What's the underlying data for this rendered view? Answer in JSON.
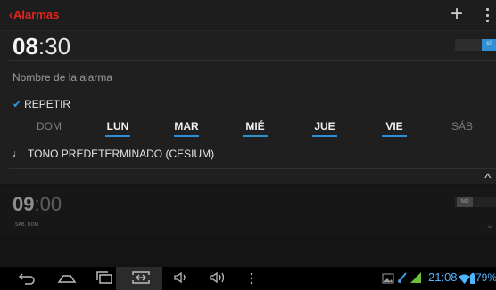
{
  "action_bar": {
    "back_chevron": "‹",
    "title": "Alarmas",
    "add_icon": "+",
    "accent": "#e8221c"
  },
  "alarm1": {
    "time_hour": "08",
    "time_minute": ":30",
    "switch_label": "SÍ",
    "name_placeholder": "Nombre de la alarma",
    "repeat_label": "REPETIR",
    "days": [
      {
        "label": "DOM",
        "active": false
      },
      {
        "label": "LUN",
        "active": true
      },
      {
        "label": "MAR",
        "active": true
      },
      {
        "label": "MIÉ",
        "active": true
      },
      {
        "label": "JUE",
        "active": true
      },
      {
        "label": "VIE",
        "active": true
      },
      {
        "label": "SÁB",
        "active": false
      }
    ],
    "ringtone": "TONO PREDETERMINADO (CESIUM)",
    "switch_color": "#2f8fd2"
  },
  "alarm2": {
    "time_hour": "09",
    "time_minute": ":00",
    "switch_label": "NO",
    "days_summary": "SÁB, DOM"
  },
  "status_bar": {
    "time": "21:08",
    "battery": "79%"
  }
}
